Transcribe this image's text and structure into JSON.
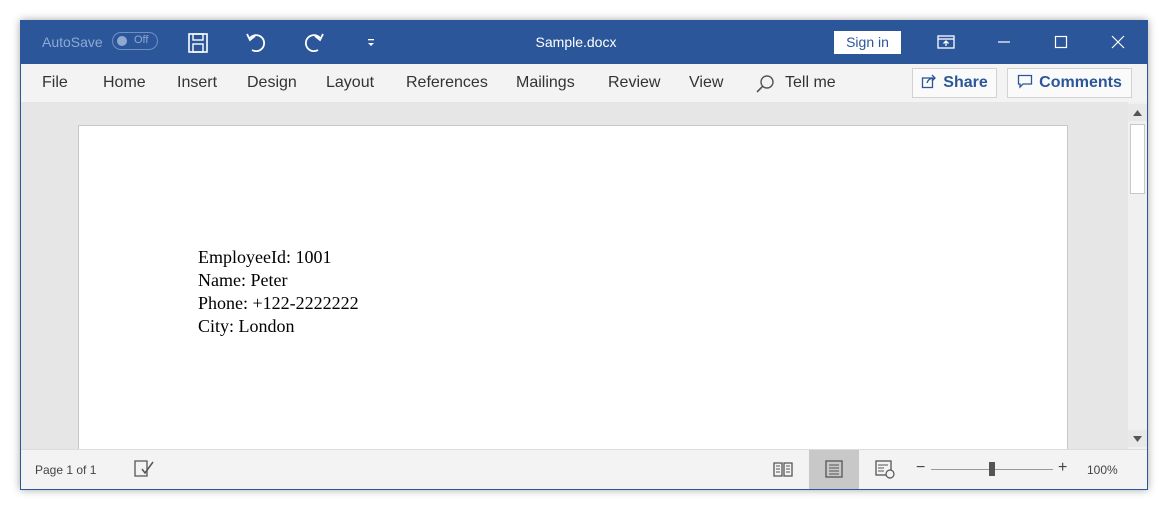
{
  "titlebar": {
    "autosave_label": "AutoSave",
    "autosave_state": "Off",
    "document_title": "Sample.docx",
    "signin_label": "Sign in",
    "icons": [
      "save-icon",
      "undo-icon",
      "redo-icon",
      "customize-qat-icon",
      "ribbon-display-options-icon",
      "minimize-icon",
      "maximize-icon",
      "close-icon"
    ]
  },
  "ribbon": {
    "tabs": [
      "File",
      "Home",
      "Insert",
      "Design",
      "Layout",
      "References",
      "Mailings",
      "Review",
      "View"
    ],
    "tell_me": "Tell me",
    "share_label": "Share",
    "comments_label": "Comments"
  },
  "document": {
    "lines": [
      "EmployeeId: 1001",
      "Name: Peter",
      "Phone: +122-2222222",
      "City: London"
    ]
  },
  "statusbar": {
    "page_info": "Page 1 of 1",
    "zoom_minus": "−",
    "zoom_plus": "+",
    "zoom_level": "100%",
    "active_view": "print-layout"
  },
  "colors": {
    "accent": "#2b579a",
    "ribbon_bg": "#f3f3f3",
    "canvas_bg": "#e6e6e6"
  }
}
